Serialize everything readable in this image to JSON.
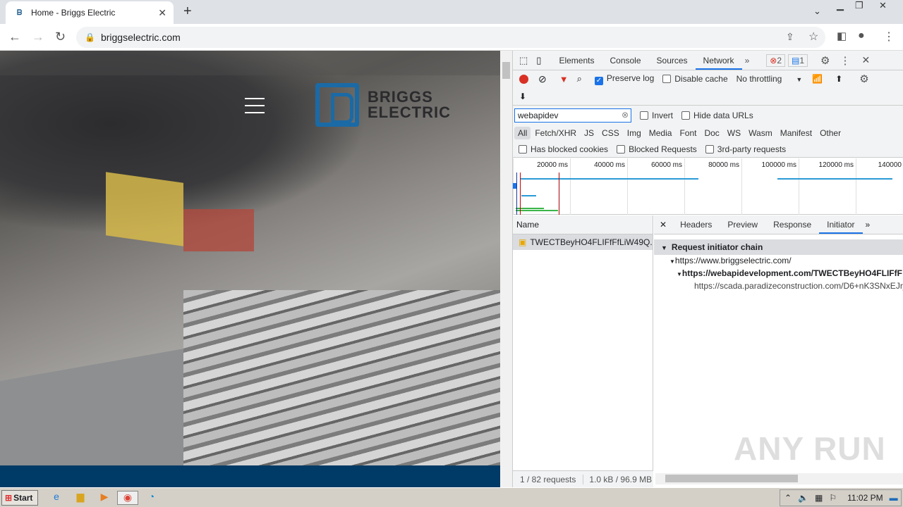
{
  "browser": {
    "tab_title": "Home - Briggs Electric",
    "url": "briggselectric.com"
  },
  "page": {
    "logo_line1": "BRIGGS",
    "logo_line2": "ELECTRIC"
  },
  "devtools": {
    "tabs": [
      "Elements",
      "Console",
      "Sources",
      "Network"
    ],
    "error_count": "2",
    "message_count": "1",
    "preserve_log": "Preserve log",
    "disable_cache": "Disable cache",
    "throttling": "No throttling",
    "filter_value": "webapidev",
    "invert": "Invert",
    "hide_data_urls": "Hide data URLs",
    "type_filters": [
      "All",
      "Fetch/XHR",
      "JS",
      "CSS",
      "Img",
      "Media",
      "Font",
      "Doc",
      "WS",
      "Wasm",
      "Manifest",
      "Other"
    ],
    "has_blocked_cookies": "Has blocked cookies",
    "blocked_requests": "Blocked Requests",
    "third_party": "3rd-party requests",
    "timeline_ticks": [
      "20000 ms",
      "40000 ms",
      "60000 ms",
      "80000 ms",
      "100000 ms",
      "120000 ms",
      "140000"
    ],
    "name_header": "Name",
    "request_name": "TWECTBeyHO4FLIFfFfLiW49Q...",
    "detail_tabs": [
      "Headers",
      "Preview",
      "Response",
      "Initiator"
    ],
    "initiator_title": "Request initiator chain",
    "chain": [
      "https://www.briggselectric.com/",
      "https://webapidevelopment.com/TWECTBeyHO4FLIFfF",
      "https://scada.paradizeconstruction.com/D6+nK3SNxEJrj"
    ],
    "status_requests": "1 / 82 requests",
    "status_size": "1.0 kB / 96.9 MB"
  },
  "taskbar": {
    "start": "Start",
    "clock": "11:02 PM"
  },
  "watermark": "ANY RUN"
}
